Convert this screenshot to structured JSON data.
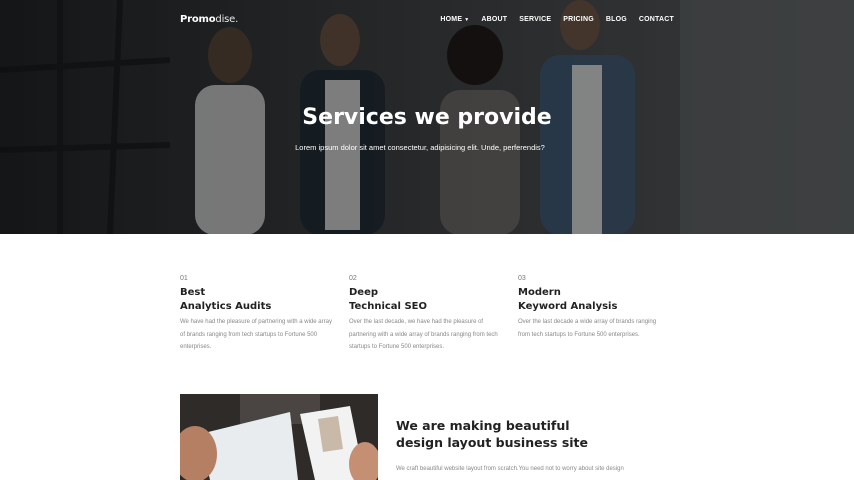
{
  "brand": {
    "bold": "Promo",
    "thin": "dise."
  },
  "nav": [
    {
      "label": "HOME",
      "has_dropdown": true
    },
    {
      "label": "ABOUT"
    },
    {
      "label": "SERVICE"
    },
    {
      "label": "PRICING"
    },
    {
      "label": "BLOG"
    },
    {
      "label": "CONTACT"
    }
  ],
  "hero": {
    "title": "Services we provide",
    "subtitle": "Lorem ipsum dolor sit amet consectetur, adipisicing elit. Unde, perferendis?"
  },
  "services": [
    {
      "number": "01",
      "title_line1": "Best",
      "title_line2": "Analytics Audits",
      "description": "We have had the pleasure of partnering with a wide array of brands ranging from tech startups to Fortune 500 enterprises."
    },
    {
      "number": "02",
      "title_line1": "Deep",
      "title_line2": "Technical SEO",
      "description": "Over the last decade, we have had the pleasure of partnering with a wide array of brands ranging from tech startups to Fortune 500 enterprises."
    },
    {
      "number": "03",
      "title_line1": "Modern",
      "title_line2": "Keyword Analysis",
      "description": "Over the last decade a wide array of brands ranging from tech startups to Fortune 500 enterprises."
    }
  ],
  "about": {
    "title_line1": "We are making beautiful",
    "title_line2": "design layout business site",
    "text": "We craft beautiful website layout from scratch.You need not to worry about site design"
  },
  "colors": {
    "hero_bg": "#2b2d2f",
    "white": "#ffffff",
    "heading": "#222222",
    "body_text": "#888888"
  }
}
